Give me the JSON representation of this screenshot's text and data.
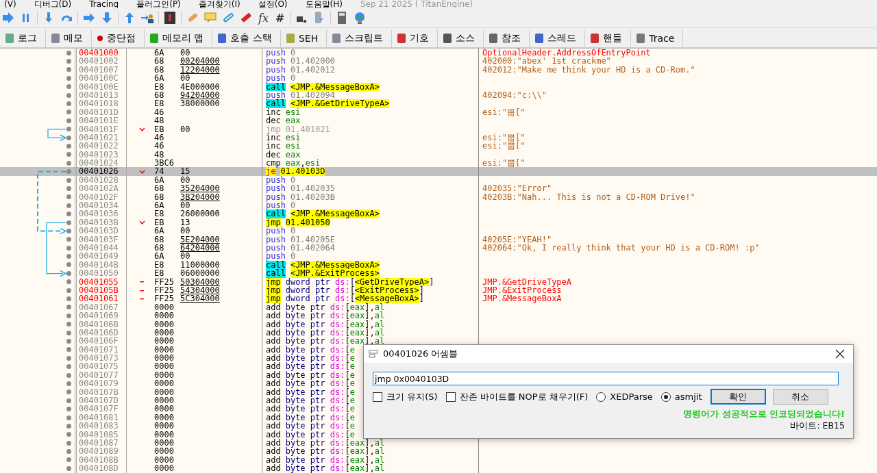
{
  "menu": [
    "(V)",
    "디버그(D)",
    "Tracing",
    "플러그인(P)",
    "즐겨찾기(I)",
    "설정(O)",
    "도움말(H)"
  ],
  "build_info": "Sep 21 2025 ( TitanEngine)",
  "toolbar": {
    "glyphs": [
      "fx",
      "#"
    ]
  },
  "tabs": [
    {
      "label": "로그"
    },
    {
      "label": "메모"
    },
    {
      "label": "중단점"
    },
    {
      "label": "메모리 맵"
    },
    {
      "label": "호출 스택"
    },
    {
      "label": "SEH"
    },
    {
      "label": "스크립트"
    },
    {
      "label": "기호"
    },
    {
      "label": "소스"
    },
    {
      "label": "참조"
    },
    {
      "label": "스레드"
    },
    {
      "label": "핸들"
    },
    {
      "label": "Trace"
    }
  ],
  "rows": [
    {
      "addr": {
        "text": "00401000",
        "kind": "label"
      },
      "selected": false,
      "opcode": "6A",
      "imm": {
        "text": "00",
        "ref": false
      },
      "mnemonic": {
        "text": "push",
        "kind": "push"
      },
      "ops": [
        {
          "text": "0",
          "kind": "num"
        }
      ],
      "comment": {
        "text": "OptionalHeader.AddressOfEntryPoint",
        "kind": "auto"
      }
    },
    {
      "addr": {
        "text": "00401002",
        "kind": "normal"
      },
      "selected": false,
      "opcode": "68",
      "imm": {
        "text": "00204000",
        "ref": true
      },
      "mnemonic": {
        "text": "push",
        "kind": "push"
      },
      "ops": [
        {
          "text": "01.402000",
          "kind": "num"
        }
      ],
      "comment": {
        "text": "402000:\"abex' 1st crackme\"",
        "kind": "string"
      }
    },
    {
      "addr": {
        "text": "00401007",
        "kind": "normal"
      },
      "selected": false,
      "opcode": "68",
      "imm": {
        "text": "12204000",
        "ref": true
      },
      "mnemonic": {
        "text": "push",
        "kind": "push"
      },
      "ops": [
        {
          "text": "01.402012",
          "kind": "num"
        }
      ],
      "comment": {
        "text": "402012:\"Make me think your HD is a CD-Rom.\"",
        "kind": "string"
      }
    },
    {
      "addr": {
        "text": "0040100C",
        "kind": "normal"
      },
      "selected": false,
      "opcode": "6A",
      "imm": {
        "text": "00",
        "ref": false
      },
      "mnemonic": {
        "text": "push",
        "kind": "push"
      },
      "ops": [
        {
          "text": "0",
          "kind": "num"
        }
      ]
    },
    {
      "addr": {
        "text": "0040100E",
        "kind": "normal"
      },
      "selected": false,
      "opcode": "E8",
      "imm": {
        "text": "4E000000",
        "ref": false
      },
      "mnemonic": {
        "text": "call",
        "kind": "call"
      },
      "ops": [
        {
          "text": "<JMP.&MessageBoxA>",
          "kind": "label"
        }
      ]
    },
    {
      "addr": {
        "text": "00401013",
        "kind": "normal"
      },
      "selected": false,
      "opcode": "68",
      "imm": {
        "text": "94204000",
        "ref": true
      },
      "mnemonic": {
        "text": "push",
        "kind": "push"
      },
      "ops": [
        {
          "text": "01.402094",
          "kind": "num"
        }
      ],
      "comment": {
        "text": "402094:\"c:\\\\\"",
        "kind": "string"
      }
    },
    {
      "addr": {
        "text": "00401018",
        "kind": "normal"
      },
      "selected": false,
      "opcode": "E8",
      "imm": {
        "text": "38000000",
        "ref": false
      },
      "mnemonic": {
        "text": "call",
        "kind": "call"
      },
      "ops": [
        {
          "text": "<JMP.&GetDriveTypeA>",
          "kind": "label"
        }
      ]
    },
    {
      "addr": {
        "text": "0040101D",
        "kind": "normal"
      },
      "selected": false,
      "opcode": "46",
      "mnemonic": {
        "text": "inc",
        "kind": "plain"
      },
      "ops": [
        {
          "text": "esi",
          "kind": "reg"
        }
      ],
      "comment": {
        "text": "esi:\"뿝[\"",
        "kind": "string"
      }
    },
    {
      "addr": {
        "text": "0040101E",
        "kind": "normal"
      },
      "selected": false,
      "opcode": "48",
      "mnemonic": {
        "text": "dec",
        "kind": "plain"
      },
      "ops": [
        {
          "text": "eax",
          "kind": "reg"
        }
      ]
    },
    {
      "addr": {
        "text": "0040101F",
        "kind": "normal"
      },
      "selected": false,
      "marker": {
        "kind": "jump"
      },
      "opcode": "EB",
      "imm": {
        "text": "00",
        "ref": false
      },
      "mnemonic": {
        "text": "jmp",
        "kind": "dim"
      },
      "ops": [
        {
          "text": "01.401021",
          "kind": "dim"
        }
      ],
      "jump": {
        "kind": "solid"
      }
    },
    {
      "addr": {
        "text": "00401021",
        "kind": "normal"
      },
      "selected": false,
      "opcode": "46",
      "mnemonic": {
        "text": "inc",
        "kind": "plain"
      },
      "ops": [
        {
          "text": "esi",
          "kind": "reg"
        }
      ],
      "comment": {
        "text": "esi:\"뿝[\"",
        "kind": "string"
      },
      "landing": {
        "kind": "solid"
      }
    },
    {
      "addr": {
        "text": "00401022",
        "kind": "normal"
      },
      "selected": false,
      "opcode": "46",
      "mnemonic": {
        "text": "inc",
        "kind": "plain"
      },
      "ops": [
        {
          "text": "esi",
          "kind": "reg"
        }
      ],
      "comment": {
        "text": "esi:\"뿝[\"",
        "kind": "string"
      }
    },
    {
      "addr": {
        "text": "00401023",
        "kind": "normal"
      },
      "selected": false,
      "opcode": "48",
      "mnemonic": {
        "text": "dec",
        "kind": "plain"
      },
      "ops": [
        {
          "text": "eax",
          "kind": "reg"
        }
      ]
    },
    {
      "addr": {
        "text": "00401024",
        "kind": "normal"
      },
      "selected": false,
      "opcode": "3BC6",
      "mnemonic": {
        "text": "cmp",
        "kind": "plain"
      },
      "ops": [
        {
          "text": "eax",
          "kind": "reg"
        },
        {
          "text": ",",
          "kind": "p"
        },
        {
          "text": "esi",
          "kind": "reg"
        }
      ],
      "comment": {
        "text": "esi:\"뿝[\"",
        "kind": "string"
      }
    },
    {
      "addr": {
        "text": "00401026",
        "kind": "normal"
      },
      "selected": true,
      "marker": {
        "kind": "jump"
      },
      "opcode": "74",
      "imm": {
        "text": "15",
        "ref": false
      },
      "mnemonic": {
        "text": "je",
        "kind": "jcc"
      },
      "ops": [
        {
          "text": "01.40103D",
          "kind": "label"
        }
      ],
      "jump": {
        "kind": "dashed"
      }
    },
    {
      "addr": {
        "text": "00401028",
        "kind": "normal"
      },
      "selected": false,
      "opcode": "6A",
      "imm": {
        "text": "00",
        "ref": false
      },
      "mnemonic": {
        "text": "push",
        "kind": "push"
      },
      "ops": [
        {
          "text": "0",
          "kind": "num"
        }
      ]
    },
    {
      "addr": {
        "text": "0040102A",
        "kind": "normal"
      },
      "selected": false,
      "opcode": "68",
      "imm": {
        "text": "35204000",
        "ref": true
      },
      "mnemonic": {
        "text": "push",
        "kind": "push"
      },
      "ops": [
        {
          "text": "01.402035",
          "kind": "num"
        }
      ],
      "comment": {
        "text": "402035:\"Error\"",
        "kind": "string"
      }
    },
    {
      "addr": {
        "text": "0040102F",
        "kind": "normal"
      },
      "selected": false,
      "opcode": "68",
      "imm": {
        "text": "3B204000",
        "ref": true
      },
      "mnemonic": {
        "text": "push",
        "kind": "push"
      },
      "ops": [
        {
          "text": "01.40203B",
          "kind": "num"
        }
      ],
      "comment": {
        "text": "40203B:\"Nah... This is not a CD-ROM Drive!\"",
        "kind": "string"
      }
    },
    {
      "addr": {
        "text": "00401034",
        "kind": "normal"
      },
      "selected": false,
      "opcode": "6A",
      "imm": {
        "text": "00",
        "ref": false
      },
      "mnemonic": {
        "text": "push",
        "kind": "push"
      },
      "ops": [
        {
          "text": "0",
          "kind": "num"
        }
      ]
    },
    {
      "addr": {
        "text": "00401036",
        "kind": "normal"
      },
      "selected": false,
      "opcode": "E8",
      "imm": {
        "text": "26000000",
        "ref": false
      },
      "mnemonic": {
        "text": "call",
        "kind": "call"
      },
      "ops": [
        {
          "text": "<JMP.&MessageBoxA>",
          "kind": "label"
        }
      ]
    },
    {
      "addr": {
        "text": "0040103B",
        "kind": "normal"
      },
      "selected": false,
      "marker": {
        "kind": "jump"
      },
      "opcode": "EB",
      "imm": {
        "text": "13",
        "ref": false
      },
      "mnemonic": {
        "text": "jmp",
        "kind": "jmp"
      },
      "ops": [
        {
          "text": "01.401050",
          "kind": "label"
        }
      ],
      "jump": {
        "kind": "solid"
      }
    },
    {
      "addr": {
        "text": "0040103D",
        "kind": "normal"
      },
      "selected": false,
      "opcode": "6A",
      "imm": {
        "text": "00",
        "ref": false
      },
      "mnemonic": {
        "text": "push",
        "kind": "push"
      },
      "ops": [
        {
          "text": "0",
          "kind": "num"
        }
      ],
      "landing": {
        "kind": "dashed"
      }
    },
    {
      "addr": {
        "text": "0040103F",
        "kind": "normal"
      },
      "selected": false,
      "opcode": "68",
      "imm": {
        "text": "5E204000",
        "ref": true
      },
      "mnemonic": {
        "text": "push",
        "kind": "push"
      },
      "ops": [
        {
          "text": "01.40205E",
          "kind": "num"
        }
      ],
      "comment": {
        "text": "40205E:\"YEAH!\"",
        "kind": "string"
      }
    },
    {
      "addr": {
        "text": "00401044",
        "kind": "normal"
      },
      "selected": false,
      "opcode": "68",
      "imm": {
        "text": "64204000",
        "ref": true
      },
      "mnemonic": {
        "text": "push",
        "kind": "push"
      },
      "ops": [
        {
          "text": "01.402064",
          "kind": "num"
        }
      ],
      "comment": {
        "text": "402064:\"Ok, I really think that your HD is a CD-ROM! :p\"",
        "kind": "string"
      }
    },
    {
      "addr": {
        "text": "00401049",
        "kind": "normal"
      },
      "selected": false,
      "opcode": "6A",
      "imm": {
        "text": "00",
        "ref": false
      },
      "mnemonic": {
        "text": "push",
        "kind": "push"
      },
      "ops": [
        {
          "text": "0",
          "kind": "num"
        }
      ]
    },
    {
      "addr": {
        "text": "0040104B",
        "kind": "normal"
      },
      "selected": false,
      "opcode": "E8",
      "imm": {
        "text": "11000000",
        "ref": false
      },
      "mnemonic": {
        "text": "call",
        "kind": "call"
      },
      "ops": [
        {
          "text": "<JMP.&MessageBoxA>",
          "kind": "label"
        }
      ]
    },
    {
      "addr": {
        "text": "00401050",
        "kind": "normal"
      },
      "selected": false,
      "opcode": "E8",
      "imm": {
        "text": "06000000",
        "ref": false
      },
      "mnemonic": {
        "text": "call",
        "kind": "call"
      },
      "ops": [
        {
          "text": "<JMP.&ExitProcess>",
          "kind": "label"
        }
      ],
      "landing": {
        "kind": "solid"
      }
    },
    {
      "addr": {
        "text": "00401055",
        "kind": "label"
      },
      "selected": false,
      "marker": {
        "kind": "thunk"
      },
      "opcode": "FF25",
      "imm": {
        "text": "50304000",
        "ref": true
      },
      "mnemonic": {
        "text": "jmp",
        "kind": "jmp"
      },
      "ops": [
        {
          "text": "dword ptr ",
          "kind": "kw"
        },
        {
          "text": "ds:",
          "kind": "seg"
        },
        {
          "text": "[",
          "kind": "p"
        },
        {
          "text": "<GetDriveTypeA>",
          "kind": "label"
        },
        {
          "text": "]",
          "kind": "p"
        }
      ],
      "comment": {
        "text": "JMP.&GetDriveTypeA",
        "kind": "auto"
      }
    },
    {
      "addr": {
        "text": "0040105B",
        "kind": "label"
      },
      "selected": false,
      "marker": {
        "kind": "thunk"
      },
      "opcode": "FF25",
      "imm": {
        "text": "54304000",
        "ref": true
      },
      "mnemonic": {
        "text": "jmp",
        "kind": "jmp"
      },
      "ops": [
        {
          "text": "dword ptr ",
          "kind": "kw"
        },
        {
          "text": "ds:",
          "kind": "seg"
        },
        {
          "text": "[",
          "kind": "p"
        },
        {
          "text": "<ExitProcess>",
          "kind": "label"
        },
        {
          "text": "]",
          "kind": "p"
        }
      ],
      "comment": {
        "text": "JMP.&ExitProcess",
        "kind": "auto"
      }
    },
    {
      "addr": {
        "text": "00401061",
        "kind": "label"
      },
      "selected": false,
      "marker": {
        "kind": "thunk"
      },
      "opcode": "FF25",
      "imm": {
        "text": "5C304000",
        "ref": true
      },
      "mnemonic": {
        "text": "jmp",
        "kind": "jmp"
      },
      "ops": [
        {
          "text": "dword ptr ",
          "kind": "kw"
        },
        {
          "text": "ds:",
          "kind": "seg"
        },
        {
          "text": "[",
          "kind": "p"
        },
        {
          "text": "<MessageBoxA>",
          "kind": "label"
        },
        {
          "text": "]",
          "kind": "p"
        }
      ],
      "comment": {
        "text": "JMP.&MessageBoxA",
        "kind": "auto"
      }
    },
    {
      "addr": {
        "text": "00401067",
        "kind": "normal"
      },
      "selected": false,
      "opcode": "0000",
      "mnemonic": {
        "text": "add",
        "kind": "plain"
      },
      "ops": [
        {
          "text": "byte ptr ",
          "kind": "kw"
        },
        {
          "text": "ds:",
          "kind": "seg"
        },
        {
          "text": "[",
          "kind": "p"
        },
        {
          "text": "eax",
          "kind": "reg"
        },
        {
          "text": "],",
          "kind": "p"
        },
        {
          "text": "al",
          "kind": "reg"
        }
      ]
    },
    {
      "addr": {
        "text": "00401069",
        "kind": "normal"
      },
      "selected": false,
      "opcode": "0000",
      "mnemonic": {
        "text": "add",
        "kind": "plain"
      },
      "ops": [
        {
          "text": "byte ptr ",
          "kind": "kw"
        },
        {
          "text": "ds:",
          "kind": "seg"
        },
        {
          "text": "[",
          "kind": "p"
        },
        {
          "text": "eax",
          "kind": "reg"
        },
        {
          "text": "],",
          "kind": "p"
        },
        {
          "text": "al",
          "kind": "reg"
        }
      ]
    },
    {
      "addr": {
        "text": "0040106B",
        "kind": "normal"
      },
      "selected": false,
      "opcode": "0000",
      "mnemonic": {
        "text": "add",
        "kind": "plain"
      },
      "ops": [
        {
          "text": "byte ptr ",
          "kind": "kw"
        },
        {
          "text": "ds:",
          "kind": "seg"
        },
        {
          "text": "[",
          "kind": "p"
        },
        {
          "text": "eax",
          "kind": "reg"
        },
        {
          "text": "],",
          "kind": "p"
        },
        {
          "text": "al",
          "kind": "reg"
        }
      ]
    },
    {
      "addr": {
        "text": "0040106D",
        "kind": "normal"
      },
      "selected": false,
      "opcode": "0000",
      "mnemonic": {
        "text": "add",
        "kind": "plain"
      },
      "ops": [
        {
          "text": "byte ptr ",
          "kind": "kw"
        },
        {
          "text": "ds:",
          "kind": "seg"
        },
        {
          "text": "[",
          "kind": "p"
        },
        {
          "text": "eax",
          "kind": "reg"
        },
        {
          "text": "],",
          "kind": "p"
        },
        {
          "text": "al",
          "kind": "reg"
        }
      ]
    },
    {
      "addr": {
        "text": "0040106F",
        "kind": "normal"
      },
      "selected": false,
      "opcode": "0000",
      "mnemonic": {
        "text": "add",
        "kind": "plain"
      },
      "ops": [
        {
          "text": "byte ptr ",
          "kind": "kw"
        },
        {
          "text": "ds:",
          "kind": "seg"
        },
        {
          "text": "[",
          "kind": "p"
        },
        {
          "text": "eax",
          "kind": "reg"
        },
        {
          "text": "],",
          "kind": "p"
        },
        {
          "text": "al",
          "kind": "reg"
        }
      ]
    },
    {
      "addr": {
        "text": "00401071",
        "kind": "normal"
      },
      "selected": false,
      "opcode": "0000",
      "mnemonic": {
        "text": "add",
        "kind": "plain"
      },
      "ops": [
        {
          "text": "byte ptr ",
          "kind": "kw"
        },
        {
          "text": "ds:",
          "kind": "seg"
        },
        {
          "text": "[",
          "kind": "p"
        },
        {
          "text": "e",
          "kind": "reg"
        }
      ]
    },
    {
      "addr": {
        "text": "00401073",
        "kind": "normal"
      },
      "selected": false,
      "opcode": "0000",
      "mnemonic": {
        "text": "add",
        "kind": "plain"
      },
      "ops": [
        {
          "text": "byte ptr ",
          "kind": "kw"
        },
        {
          "text": "ds:",
          "kind": "seg"
        },
        {
          "text": "[",
          "kind": "p"
        },
        {
          "text": "e",
          "kind": "reg"
        }
      ]
    },
    {
      "addr": {
        "text": "00401075",
        "kind": "normal"
      },
      "selected": false,
      "opcode": "0000",
      "mnemonic": {
        "text": "add",
        "kind": "plain"
      },
      "ops": [
        {
          "text": "byte ptr ",
          "kind": "kw"
        },
        {
          "text": "ds:",
          "kind": "seg"
        },
        {
          "text": "[",
          "kind": "p"
        },
        {
          "text": "e",
          "kind": "reg"
        }
      ]
    },
    {
      "addr": {
        "text": "00401077",
        "kind": "normal"
      },
      "selected": false,
      "opcode": "0000",
      "mnemonic": {
        "text": "add",
        "kind": "plain"
      },
      "ops": [
        {
          "text": "byte ptr ",
          "kind": "kw"
        },
        {
          "text": "ds:",
          "kind": "seg"
        },
        {
          "text": "[",
          "kind": "p"
        },
        {
          "text": "e",
          "kind": "reg"
        }
      ]
    },
    {
      "addr": {
        "text": "00401079",
        "kind": "normal"
      },
      "selected": false,
      "opcode": "0000",
      "mnemonic": {
        "text": "add",
        "kind": "plain"
      },
      "ops": [
        {
          "text": "byte ptr ",
          "kind": "kw"
        },
        {
          "text": "ds:",
          "kind": "seg"
        },
        {
          "text": "[",
          "kind": "p"
        },
        {
          "text": "e",
          "kind": "reg"
        }
      ]
    },
    {
      "addr": {
        "text": "0040107B",
        "kind": "normal"
      },
      "selected": false,
      "opcode": "0000",
      "mnemonic": {
        "text": "add",
        "kind": "plain"
      },
      "ops": [
        {
          "text": "byte ptr ",
          "kind": "kw"
        },
        {
          "text": "ds:",
          "kind": "seg"
        },
        {
          "text": "[",
          "kind": "p"
        },
        {
          "text": "e",
          "kind": "reg"
        }
      ]
    },
    {
      "addr": {
        "text": "0040107D",
        "kind": "normal"
      },
      "selected": false,
      "opcode": "0000",
      "mnemonic": {
        "text": "add",
        "kind": "plain"
      },
      "ops": [
        {
          "text": "byte ptr ",
          "kind": "kw"
        },
        {
          "text": "ds:",
          "kind": "seg"
        },
        {
          "text": "[",
          "kind": "p"
        },
        {
          "text": "e",
          "kind": "reg"
        }
      ]
    },
    {
      "addr": {
        "text": "0040107F",
        "kind": "normal"
      },
      "selected": false,
      "opcode": "0000",
      "mnemonic": {
        "text": "add",
        "kind": "plain"
      },
      "ops": [
        {
          "text": "byte ptr ",
          "kind": "kw"
        },
        {
          "text": "ds:",
          "kind": "seg"
        },
        {
          "text": "[",
          "kind": "p"
        },
        {
          "text": "e",
          "kind": "reg"
        }
      ]
    },
    {
      "addr": {
        "text": "00401081",
        "kind": "normal"
      },
      "selected": false,
      "opcode": "0000",
      "mnemonic": {
        "text": "add",
        "kind": "plain"
      },
      "ops": [
        {
          "text": "byte ptr ",
          "kind": "kw"
        },
        {
          "text": "ds:",
          "kind": "seg"
        },
        {
          "text": "[",
          "kind": "p"
        },
        {
          "text": "e",
          "kind": "reg"
        }
      ]
    },
    {
      "addr": {
        "text": "00401083",
        "kind": "normal"
      },
      "selected": false,
      "opcode": "0000",
      "mnemonic": {
        "text": "add",
        "kind": "plain"
      },
      "ops": [
        {
          "text": "byte ptr ",
          "kind": "kw"
        },
        {
          "text": "ds:",
          "kind": "seg"
        },
        {
          "text": "[",
          "kind": "p"
        },
        {
          "text": "e",
          "kind": "reg"
        }
      ]
    },
    {
      "addr": {
        "text": "00401085",
        "kind": "normal"
      },
      "selected": false,
      "opcode": "0000",
      "mnemonic": {
        "text": "add",
        "kind": "plain"
      },
      "ops": [
        {
          "text": "byte ptr ",
          "kind": "kw"
        },
        {
          "text": "ds:",
          "kind": "seg"
        },
        {
          "text": "[",
          "kind": "p"
        },
        {
          "text": "e",
          "kind": "reg"
        }
      ]
    },
    {
      "addr": {
        "text": "00401087",
        "kind": "normal"
      },
      "selected": false,
      "opcode": "0000",
      "mnemonic": {
        "text": "add",
        "kind": "plain"
      },
      "ops": [
        {
          "text": "byte ptr ",
          "kind": "kw"
        },
        {
          "text": "ds:",
          "kind": "seg"
        },
        {
          "text": "[",
          "kind": "p"
        },
        {
          "text": "eax",
          "kind": "reg"
        },
        {
          "text": "],",
          "kind": "p"
        },
        {
          "text": "al",
          "kind": "reg"
        }
      ]
    },
    {
      "addr": {
        "text": "00401089",
        "kind": "normal"
      },
      "selected": false,
      "opcode": "0000",
      "mnemonic": {
        "text": "add",
        "kind": "plain"
      },
      "ops": [
        {
          "text": "byte ptr ",
          "kind": "kw"
        },
        {
          "text": "ds:",
          "kind": "seg"
        },
        {
          "text": "[",
          "kind": "p"
        },
        {
          "text": "eax",
          "kind": "reg"
        },
        {
          "text": "],",
          "kind": "p"
        },
        {
          "text": "al",
          "kind": "reg"
        }
      ]
    },
    {
      "addr": {
        "text": "0040108B",
        "kind": "normal"
      },
      "selected": false,
      "opcode": "0000",
      "mnemonic": {
        "text": "add",
        "kind": "plain"
      },
      "ops": [
        {
          "text": "byte ptr ",
          "kind": "kw"
        },
        {
          "text": "ds:",
          "kind": "seg"
        },
        {
          "text": "[",
          "kind": "p"
        },
        {
          "text": "eax",
          "kind": "reg"
        },
        {
          "text": "],",
          "kind": "p"
        },
        {
          "text": "al",
          "kind": "reg"
        }
      ]
    },
    {
      "addr": {
        "text": "0040108D",
        "kind": "normal"
      },
      "selected": false,
      "opcode": "0000",
      "mnemonic": {
        "text": "add",
        "kind": "plain"
      },
      "ops": [
        {
          "text": "byte ptr ",
          "kind": "kw"
        },
        {
          "text": "ds:",
          "kind": "seg"
        },
        {
          "text": "[",
          "kind": "p"
        },
        {
          "text": "eax",
          "kind": "reg"
        },
        {
          "text": "],",
          "kind": "p"
        },
        {
          "text": "al",
          "kind": "reg"
        }
      ]
    }
  ],
  "dialog": {
    "title": "00401026 어셈블",
    "input": {
      "value": "jmp 0x0040103D"
    },
    "checkboxes": [
      {
        "label": "크기 유지(S)",
        "checked": false
      },
      {
        "label": "잔존 바이트를 NOP로 채우기(F)",
        "checked": false
      }
    ],
    "radios": [
      {
        "label": "XEDParse",
        "selected": false
      },
      {
        "label": "asmjit",
        "selected": true
      }
    ],
    "buttons": [
      {
        "label": "확인",
        "default": true
      },
      {
        "label": "취소",
        "default": false
      }
    ],
    "status": "명령어가 성공적으로 인코딩되었습니다!",
    "bytes": "바이트: EB15"
  }
}
